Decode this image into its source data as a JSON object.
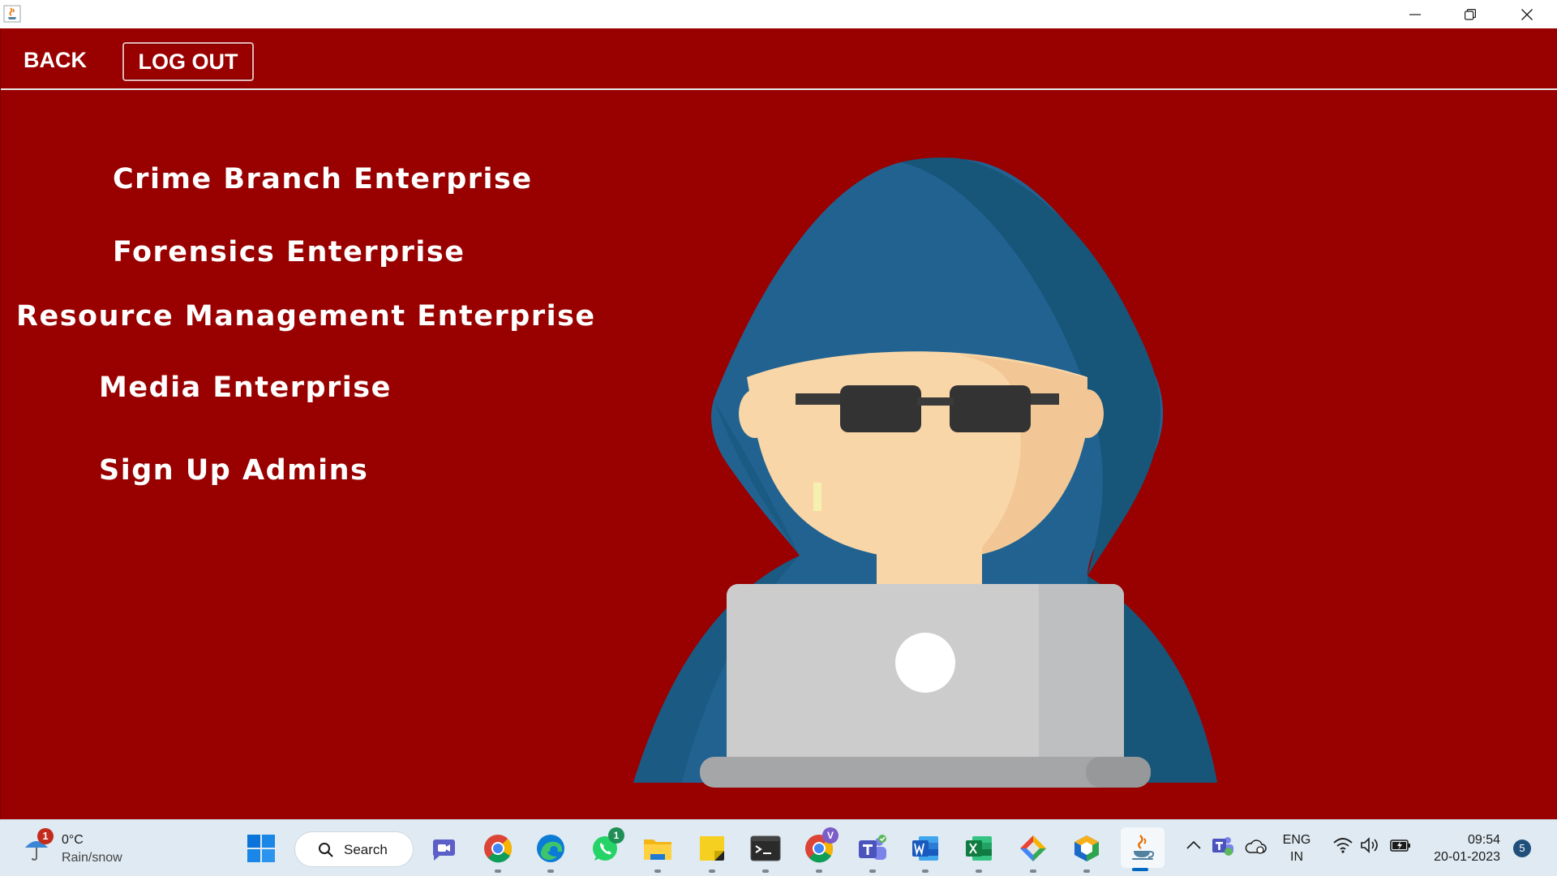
{
  "header": {
    "back_label": "BACK",
    "logout_label": "LOG OUT"
  },
  "menu": {
    "items": [
      {
        "label": "Crime Branch Enterprise"
      },
      {
        "label": "Forensics Enterprise"
      },
      {
        "label": "Resource Management Enterprise"
      },
      {
        "label": "Media Enterprise"
      },
      {
        "label": "Sign Up Admins"
      }
    ]
  },
  "illustration": {
    "icon": "hooded-hacker-laptop-icon"
  },
  "colors": {
    "background": "#990000",
    "text": "#ffffff",
    "hood": "#216291",
    "hood_shade": "#175579",
    "skin": "#f9d6a7",
    "laptop": "#cccccd"
  },
  "taskbar": {
    "weather": {
      "badge": "1",
      "temp": "0°C",
      "desc": "Rain/snow"
    },
    "search_label": "Search",
    "whatsapp_badge": "1",
    "chrome_badge": "V",
    "language": {
      "line1": "ENG",
      "line2": "IN"
    },
    "clock": {
      "time": "09:54",
      "date": "20-01-2023"
    },
    "notification_count": "5"
  }
}
